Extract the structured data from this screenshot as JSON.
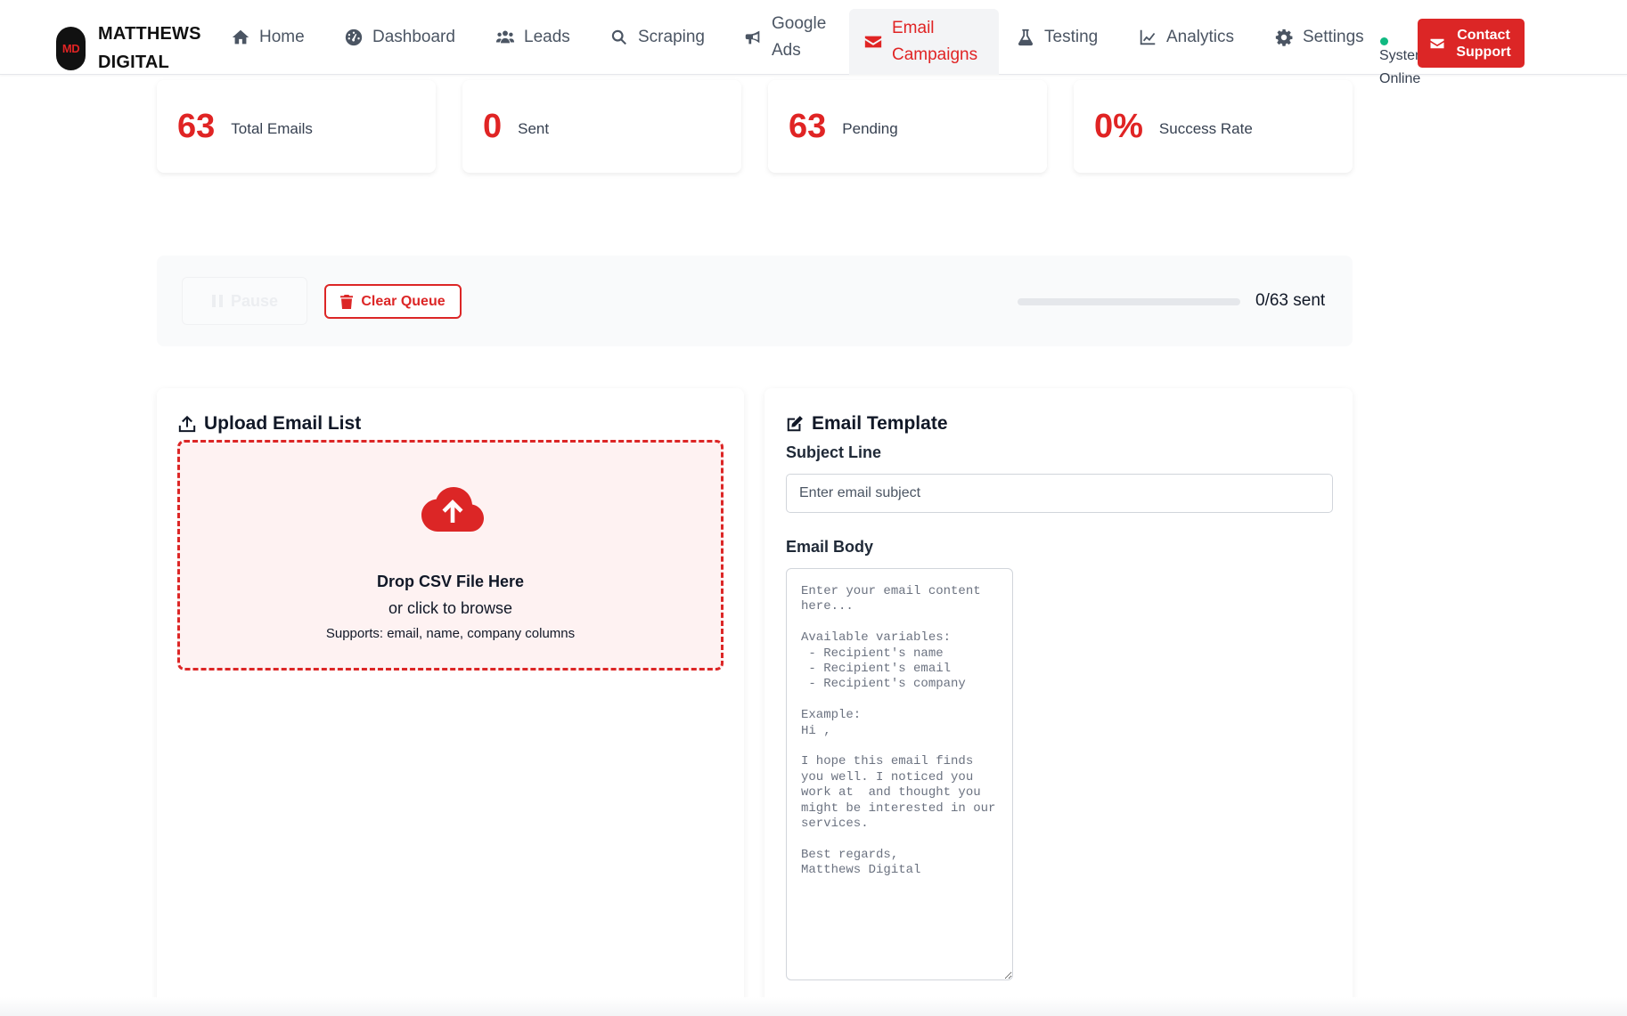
{
  "brand": {
    "logo_text": "MD",
    "name_line1": "MATTHEWS",
    "name_line2": "DIGITAL"
  },
  "nav": {
    "home": "Home",
    "dashboard": "Dashboard",
    "leads": "Leads",
    "scraping": "Scraping",
    "google_ads": "Google Ads",
    "email_campaigns": "Email Campaigns",
    "testing": "Testing",
    "analytics": "Analytics",
    "settings": "Settings"
  },
  "status": {
    "line1": "System",
    "line2": "Online",
    "color": "#10b981"
  },
  "contact_button": "Contact Support",
  "stats": [
    {
      "value": "63",
      "label": "Total Emails"
    },
    {
      "value": "0",
      "label": "Sent"
    },
    {
      "value": "63",
      "label": "Pending"
    },
    {
      "value": "0%",
      "label": "Success Rate"
    }
  ],
  "queue": {
    "pause_label": "Pause",
    "clear_label": "Clear Queue",
    "progress_fraction": 0,
    "progress_text": "0/63 sent"
  },
  "upload": {
    "title": "Upload Email List",
    "drop_title": "Drop CSV File Here",
    "drop_sub": "or click to browse",
    "drop_hint": "Supports: email, name, company columns"
  },
  "template": {
    "title": "Email Template",
    "subject_label": "Subject Line",
    "subject_placeholder": "Enter email subject",
    "subject_value": "",
    "body_label": "Email Body",
    "body_placeholder": "Enter your email content here...\n\nAvailable variables:\n - Recipient's name\n - Recipient's email\n - Recipient's company\n\nExample:\nHi ,\n\nI hope this email finds you well. I noticed you work at  and thought you might be interested in our services.\n\nBest regards,\nMatthews Digital",
    "body_value": ""
  },
  "colors": {
    "accent": "#dc2626",
    "accent_text": "#e02424",
    "dropzone_bg": "#fef2f2"
  }
}
